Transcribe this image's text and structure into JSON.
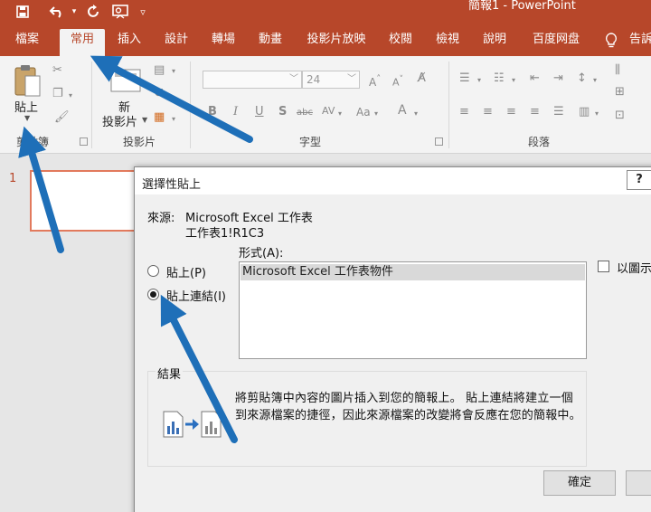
{
  "window": {
    "title": "簡報1  -  PowerPoint"
  },
  "qat": {
    "save_icon": "save-icon",
    "undo_icon": "undo-icon",
    "redo_icon": "redo-icon",
    "present_icon": "present-icon",
    "customize_icon": "customize-qat-icon"
  },
  "tabs": [
    {
      "label": "檔案",
      "active": false
    },
    {
      "label": "常用",
      "active": true
    },
    {
      "label": "插入",
      "active": false
    },
    {
      "label": "設計",
      "active": false
    },
    {
      "label": "轉場",
      "active": false
    },
    {
      "label": "動畫",
      "active": false
    },
    {
      "label": "投影片放映",
      "active": false
    },
    {
      "label": "校閱",
      "active": false
    },
    {
      "label": "檢視",
      "active": false
    },
    {
      "label": "說明",
      "active": false
    },
    {
      "label": "百度网盘",
      "active": false
    },
    {
      "label": "告訴",
      "active": false
    }
  ],
  "ribbon": {
    "paste_label": "貼上",
    "new_slide_label_line1": "新",
    "new_slide_label_line2": "投影片",
    "font_size_value": "24",
    "groups": {
      "clipboard": "剪貼簿",
      "slides": "投影片",
      "font": "字型",
      "paragraph": "段落"
    }
  },
  "slides_pane": {
    "slide_number": "1"
  },
  "dialog": {
    "title": "選擇性貼上",
    "help_label": "?",
    "source_label": "來源:",
    "source_line1": "Microsoft Excel 工作表",
    "source_line2": "工作表1!R1C3",
    "as_label": "形式(A):",
    "options": {
      "paste": "貼上(P)",
      "paste_link": "貼上連結(I)",
      "selected": "paste_link"
    },
    "as_items": [
      "Microsoft Excel 工作表物件"
    ],
    "display_as_icon_label": "以圖示",
    "display_as_icon_checked": false,
    "result_label": "結果",
    "result_text": "將剪貼簿中內容的圖片插入到您的簡報上。 貼上連結將建立一個到來源檔案的捷徑，因此來源檔案的改變將會反應在您的簡報中。",
    "ok_label": "確定"
  },
  "colors": {
    "accent": "#b7472a",
    "arrow": "#1e6fb8",
    "slide_border": "#e27a5d"
  }
}
